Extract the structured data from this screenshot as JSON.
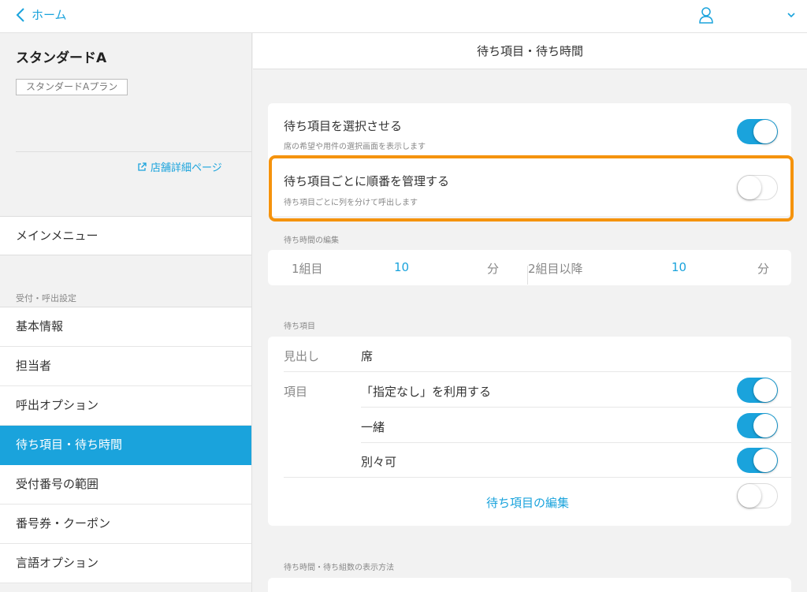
{
  "topbar": {
    "back_label": "ホーム"
  },
  "sidebar": {
    "store_name": "スタンダードA",
    "plan_badge": "スタンダードAプラン",
    "store_link": "店舗詳細ページ",
    "main_menu": "メインメニュー",
    "section_label": "受付・呼出設定",
    "items": [
      {
        "label": "基本情報",
        "active": false
      },
      {
        "label": "担当者",
        "active": false
      },
      {
        "label": "呼出オプション",
        "active": false
      },
      {
        "label": "待ち項目・待ち時間",
        "active": true
      },
      {
        "label": "受付番号の範囲",
        "active": false
      },
      {
        "label": "番号券・クーポン",
        "active": false
      },
      {
        "label": "言語オプション",
        "active": false
      }
    ]
  },
  "main": {
    "title": "待ち項目・待ち時間",
    "select_items": {
      "title": "待ち項目を選択させる",
      "subtitle": "席の希望や用件の選択画面を表示します",
      "enabled": true
    },
    "manage_order": {
      "title": "待ち項目ごとに順番を管理する",
      "subtitle": "待ち項目ごとに列を分けて呼出します",
      "enabled": false
    },
    "wait_time": {
      "label": "待ち時間の編集",
      "first_label": "1組目",
      "first_value": "10",
      "first_unit": "分",
      "second_label": "2組目以降",
      "second_value": "10",
      "second_unit": "分"
    },
    "wait_items": {
      "label": "待ち項目",
      "heading_label": "見出し",
      "heading_value": "席",
      "items_label": "項目",
      "rows": [
        {
          "label": "「指定なし」を利用する",
          "enabled": true
        },
        {
          "label": "一緒",
          "enabled": true
        },
        {
          "label": "別々可",
          "enabled": true
        }
      ],
      "edit_label": "待ち項目の編集",
      "edit_toggle_enabled": false
    },
    "display_method_label": "待ち時間・待ち組数の表示方法"
  },
  "colors": {
    "accent": "#1aa3dc",
    "highlight": "#f5930d"
  }
}
